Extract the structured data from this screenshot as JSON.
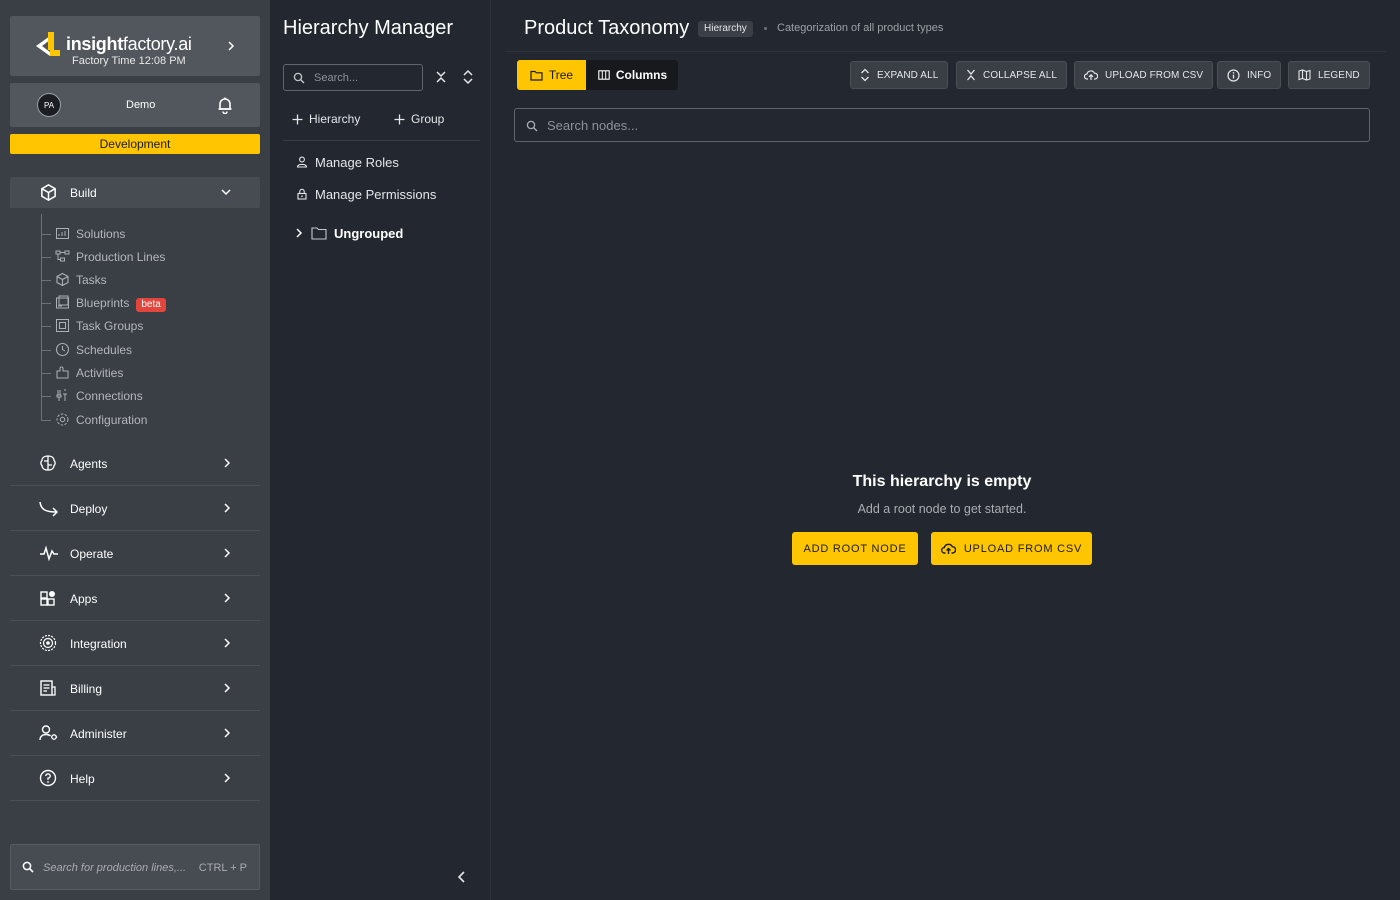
{
  "brand": {
    "name_bold": "insight",
    "name_light": "factory.ai",
    "time_label": "Factory Time 12:08 PM"
  },
  "user": {
    "initials": "PA",
    "name": "Demo"
  },
  "environment": "Development",
  "nav": {
    "build": {
      "label": "Build",
      "items": [
        {
          "label": "Solutions",
          "icon": "solutions-icon"
        },
        {
          "label": "Production Lines",
          "icon": "production-lines-icon"
        },
        {
          "label": "Tasks",
          "icon": "tasks-icon"
        },
        {
          "label": "Blueprints",
          "icon": "blueprints-icon",
          "badge": "beta"
        },
        {
          "label": "Task Groups",
          "icon": "task-groups-icon"
        },
        {
          "label": "Schedules",
          "icon": "schedules-icon"
        },
        {
          "label": "Activities",
          "icon": "activities-icon"
        },
        {
          "label": "Connections",
          "icon": "connections-icon"
        },
        {
          "label": "Configuration",
          "icon": "configuration-icon"
        }
      ]
    },
    "sections": [
      {
        "label": "Agents",
        "icon": "agents-icon"
      },
      {
        "label": "Deploy",
        "icon": "deploy-icon"
      },
      {
        "label": "Operate",
        "icon": "operate-icon"
      },
      {
        "label": "Apps",
        "icon": "apps-icon"
      },
      {
        "label": "Integration",
        "icon": "integration-icon"
      },
      {
        "label": "Billing",
        "icon": "billing-icon"
      },
      {
        "label": "Administer",
        "icon": "administer-icon"
      },
      {
        "label": "Help",
        "icon": "help-icon"
      }
    ]
  },
  "global_search": {
    "placeholder": "Search for production lines,...",
    "shortcut": "CTRL + P"
  },
  "hierarchy_panel": {
    "title": "Hierarchy Manager",
    "search_placeholder": "Search...",
    "add_hierarchy": "Hierarchy",
    "add_group": "Group",
    "manage_roles": "Manage Roles",
    "manage_permissions": "Manage Permissions",
    "group_ungrouped": "Ungrouped"
  },
  "main": {
    "title": "Product Taxonomy",
    "tag": "Hierarchy",
    "subtitle": "Categorization of all product types",
    "view_tree": "Tree",
    "view_columns": "Columns",
    "toolbar": {
      "expand_all": "EXPAND ALL",
      "collapse_all": "COLLAPSE ALL",
      "upload_csv": "UPLOAD FROM CSV",
      "info": "INFO",
      "legend": "LEGEND"
    },
    "search_placeholder": "Search nodes...",
    "empty_title": "This hierarchy is empty",
    "empty_subtitle": "Add a root node to get started.",
    "add_root_node": "ADD ROOT NODE",
    "upload_from_csv": "UPLOAD FROM CSV"
  },
  "colors": {
    "accent": "#ffc600",
    "background": "#23272f",
    "sidebar": "#3a3e45",
    "beta_badge": "#e2453c"
  }
}
